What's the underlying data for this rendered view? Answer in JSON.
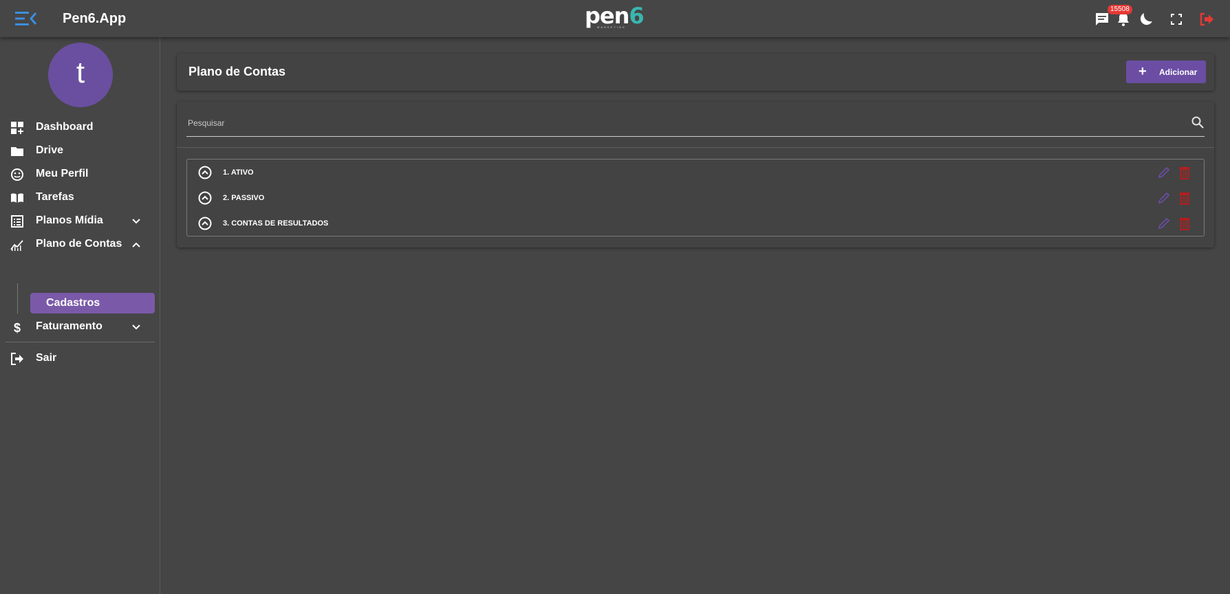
{
  "app": {
    "title": "Pen6.App"
  },
  "logo": {
    "word_main": "pen",
    "word_accent": "6",
    "sub": "MARKETING"
  },
  "topbar": {
    "notification_count": "15508"
  },
  "sidebar": {
    "avatar_letter": "t",
    "items": [
      {
        "label": "Dashboard",
        "icon": "dashboard-icon"
      },
      {
        "label": "Drive",
        "icon": "folder-icon"
      },
      {
        "label": "Meu Perfil",
        "icon": "smiley-icon"
      },
      {
        "label": "Tarefas",
        "icon": "book-icon"
      },
      {
        "label": "Planos Mídia",
        "icon": "list-icon",
        "expanded": false
      },
      {
        "label": "Plano de Contas",
        "icon": "chart-icon",
        "expanded": true
      },
      {
        "label": "Faturamento",
        "icon": "dollar-icon",
        "expanded": false
      },
      {
        "label": "Sair",
        "icon": "logout-icon"
      }
    ],
    "subitem": {
      "label": "Cadastros",
      "active": true
    }
  },
  "page": {
    "title": "Plano de Contas",
    "add_label": "Adicionar",
    "search_placeholder": "Pesquisar",
    "rows": [
      {
        "label": "1. ATIVO"
      },
      {
        "label": "2. PASSIVO"
      },
      {
        "label": "3. CONTAS DE RESULTADOS"
      }
    ]
  },
  "colors": {
    "accent": "#6b4ea3",
    "active_item": "#7a5aa8",
    "menu_icon": "#3b8fe0",
    "logout_icon": "#e53935",
    "edit_icon": "#6b4ea3",
    "delete_icon": "#b71c1c",
    "logo_accent": "#39b6b0"
  }
}
